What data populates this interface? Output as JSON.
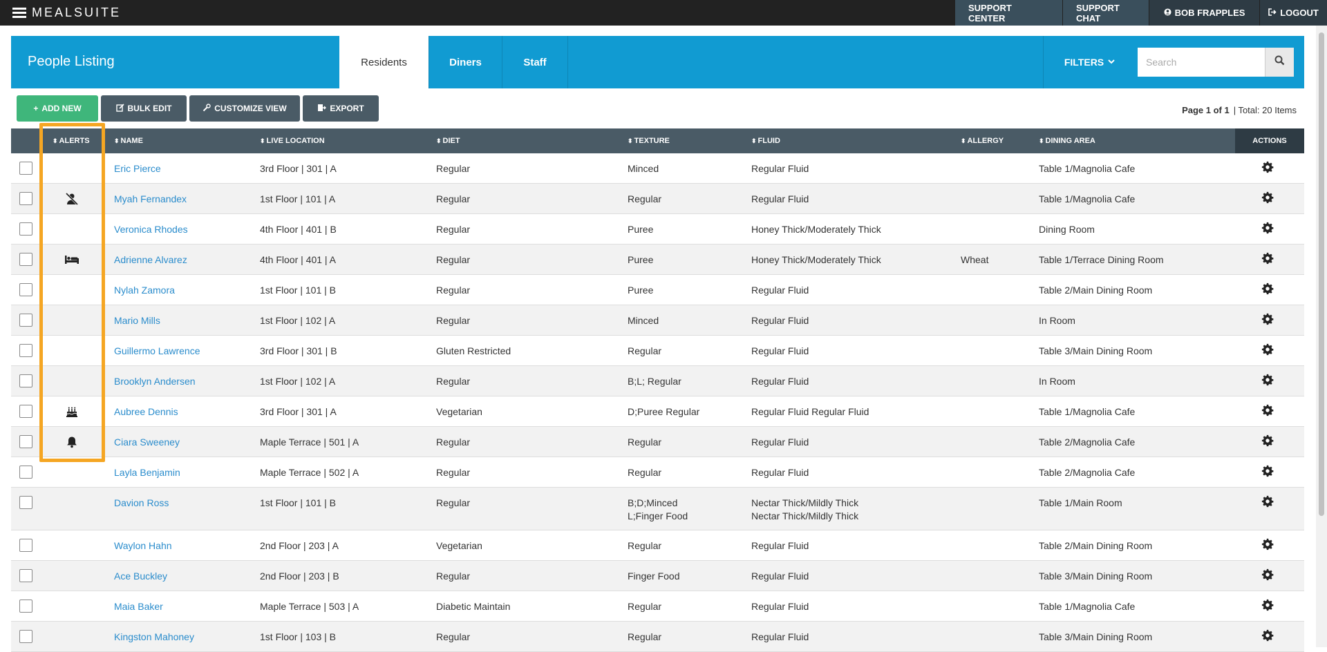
{
  "app": {
    "brand": "MEALSUITE",
    "nav": {
      "support_center": "SUPPORT CENTER",
      "support_chat": "SUPPORT CHAT",
      "user": "BOB FRAPPLES",
      "logout": "LOGOUT"
    }
  },
  "header": {
    "title": "People Listing",
    "tabs": [
      "Residents",
      "Diners",
      "Staff"
    ],
    "active_tab": "Residents",
    "filters_label": "FILTERS",
    "search_placeholder": "Search"
  },
  "toolbar": {
    "add_new": "ADD NEW",
    "bulk_edit": "BULK EDIT",
    "customize_view": "CUSTOMIZE VIEW",
    "export": "EXPORT",
    "page_info": "Page 1 of 1",
    "total": "| Total: 20 Items"
  },
  "table": {
    "columns": {
      "alerts": "ALERTS",
      "name": "NAME",
      "live_location": "LIVE LOCATION",
      "diet": "DIET",
      "texture": "TEXTURE",
      "fluid": "FLUID",
      "allergy": "ALLERGY",
      "dining_area": "DINING AREA",
      "actions": "ACTIONS"
    },
    "rows": [
      {
        "alert": "",
        "name": "Eric Pierce",
        "location": "3rd Floor | 301 | A",
        "diet": "Regular",
        "texture": "Minced",
        "fluid": "Regular Fluid",
        "allergy": "",
        "dining": "Table 1/Magnolia Cafe"
      },
      {
        "alert": "no-person-icon",
        "name": "Myah Fernandex",
        "location": "1st Floor | 101 | A",
        "diet": "Regular",
        "texture": "Regular",
        "fluid": "Regular Fluid",
        "allergy": "",
        "dining": "Table 1/Magnolia Cafe"
      },
      {
        "alert": "",
        "name": "Veronica Rhodes",
        "location": "4th Floor | 401 | B",
        "diet": "Regular",
        "texture": "Puree",
        "fluid": "Honey Thick/Moderately Thick",
        "allergy": "",
        "dining": "Dining Room"
      },
      {
        "alert": "bed-icon",
        "name": "Adrienne Alvarez",
        "location": "4th Floor | 401 | A",
        "diet": "Regular",
        "texture": "Puree",
        "fluid": "Honey Thick/Moderately Thick",
        "allergy": "Wheat",
        "dining": "Table 1/Terrace Dining Room"
      },
      {
        "alert": "",
        "name": "Nylah Zamora",
        "location": "1st Floor | 101 | B",
        "diet": "Regular",
        "texture": "Puree",
        "fluid": "Regular Fluid",
        "allergy": "",
        "dining": "Table 2/Main Dining Room"
      },
      {
        "alert": "",
        "name": "Mario Mills",
        "location": "1st Floor | 102 | A",
        "diet": "Regular",
        "texture": "Minced",
        "fluid": "Regular Fluid",
        "allergy": "",
        "dining": "In Room"
      },
      {
        "alert": "",
        "name": "Guillermo Lawrence",
        "location": "3rd Floor | 301 | B",
        "diet": "Gluten Restricted",
        "texture": "Regular",
        "fluid": "Regular Fluid",
        "allergy": "",
        "dining": "Table 3/Main Dining Room"
      },
      {
        "alert": "",
        "name": "Brooklyn Andersen",
        "location": "1st Floor | 102 | A",
        "diet": "Regular",
        "texture": "B;L; Regular",
        "fluid": "Regular Fluid",
        "allergy": "",
        "dining": "In Room"
      },
      {
        "alert": "birthday-cake-icon",
        "name": "Aubree Dennis",
        "location": "3rd Floor | 301 | A",
        "diet": "Vegetarian",
        "texture": "D;Puree Regular",
        "fluid": "Regular Fluid Regular Fluid",
        "allergy": "",
        "dining": "Table 1/Magnolia Cafe"
      },
      {
        "alert": "bell-icon",
        "name": "Ciara Sweeney",
        "location": "Maple Terrace | 501 | A",
        "diet": "Regular",
        "texture": "Regular",
        "fluid": "Regular Fluid",
        "allergy": "",
        "dining": "Table 2/Magnolia Cafe"
      },
      {
        "alert": "",
        "name": "Layla Benjamin",
        "location": "Maple Terrace | 502 | A",
        "diet": "Regular",
        "texture": "Regular",
        "fluid": "Regular Fluid",
        "allergy": "",
        "dining": "Table 2/Magnolia Cafe"
      },
      {
        "alert": "",
        "name": "Davion Ross",
        "location": "1st Floor | 101 | B",
        "diet": "Regular",
        "texture": "B;D;Minced",
        "texture2": "L;Finger Food",
        "fluid": "Nectar Thick/Mildly Thick",
        "fluid2": "Nectar Thick/Mildly Thick",
        "allergy": "",
        "dining": "Table 1/Main Room"
      },
      {
        "alert": "",
        "name": "Waylon Hahn",
        "location": "2nd Floor | 203 | A",
        "diet": "Vegetarian",
        "texture": "Regular",
        "fluid": "Regular Fluid",
        "allergy": "",
        "dining": "Table 2/Main Dining Room"
      },
      {
        "alert": "",
        "name": "Ace Buckley",
        "location": "2nd Floor | 203 | B",
        "diet": "Regular",
        "texture": "Finger Food",
        "fluid": "Regular Fluid",
        "allergy": "",
        "dining": "Table 3/Main Dining Room"
      },
      {
        "alert": "",
        "name": "Maia Baker",
        "location": "Maple Terrace | 503 | A",
        "diet": "Diabetic Maintain",
        "texture": "Regular",
        "fluid": "Regular Fluid",
        "allergy": "",
        "dining": "Table 1/Magnolia Cafe"
      },
      {
        "alert": "",
        "name": "Kingston Mahoney",
        "location": "1st Floor | 103 | B",
        "diet": "Regular",
        "texture": "Regular",
        "fluid": "Regular Fluid",
        "allergy": "",
        "dining": "Table 3/Main Dining Room"
      }
    ]
  },
  "colors": {
    "topbar": "#222222",
    "header": "#119bd2",
    "add_button": "#3fb67b",
    "dark_button": "#4a5b66",
    "link": "#2a8ccc",
    "highlight": "#f5a623"
  }
}
